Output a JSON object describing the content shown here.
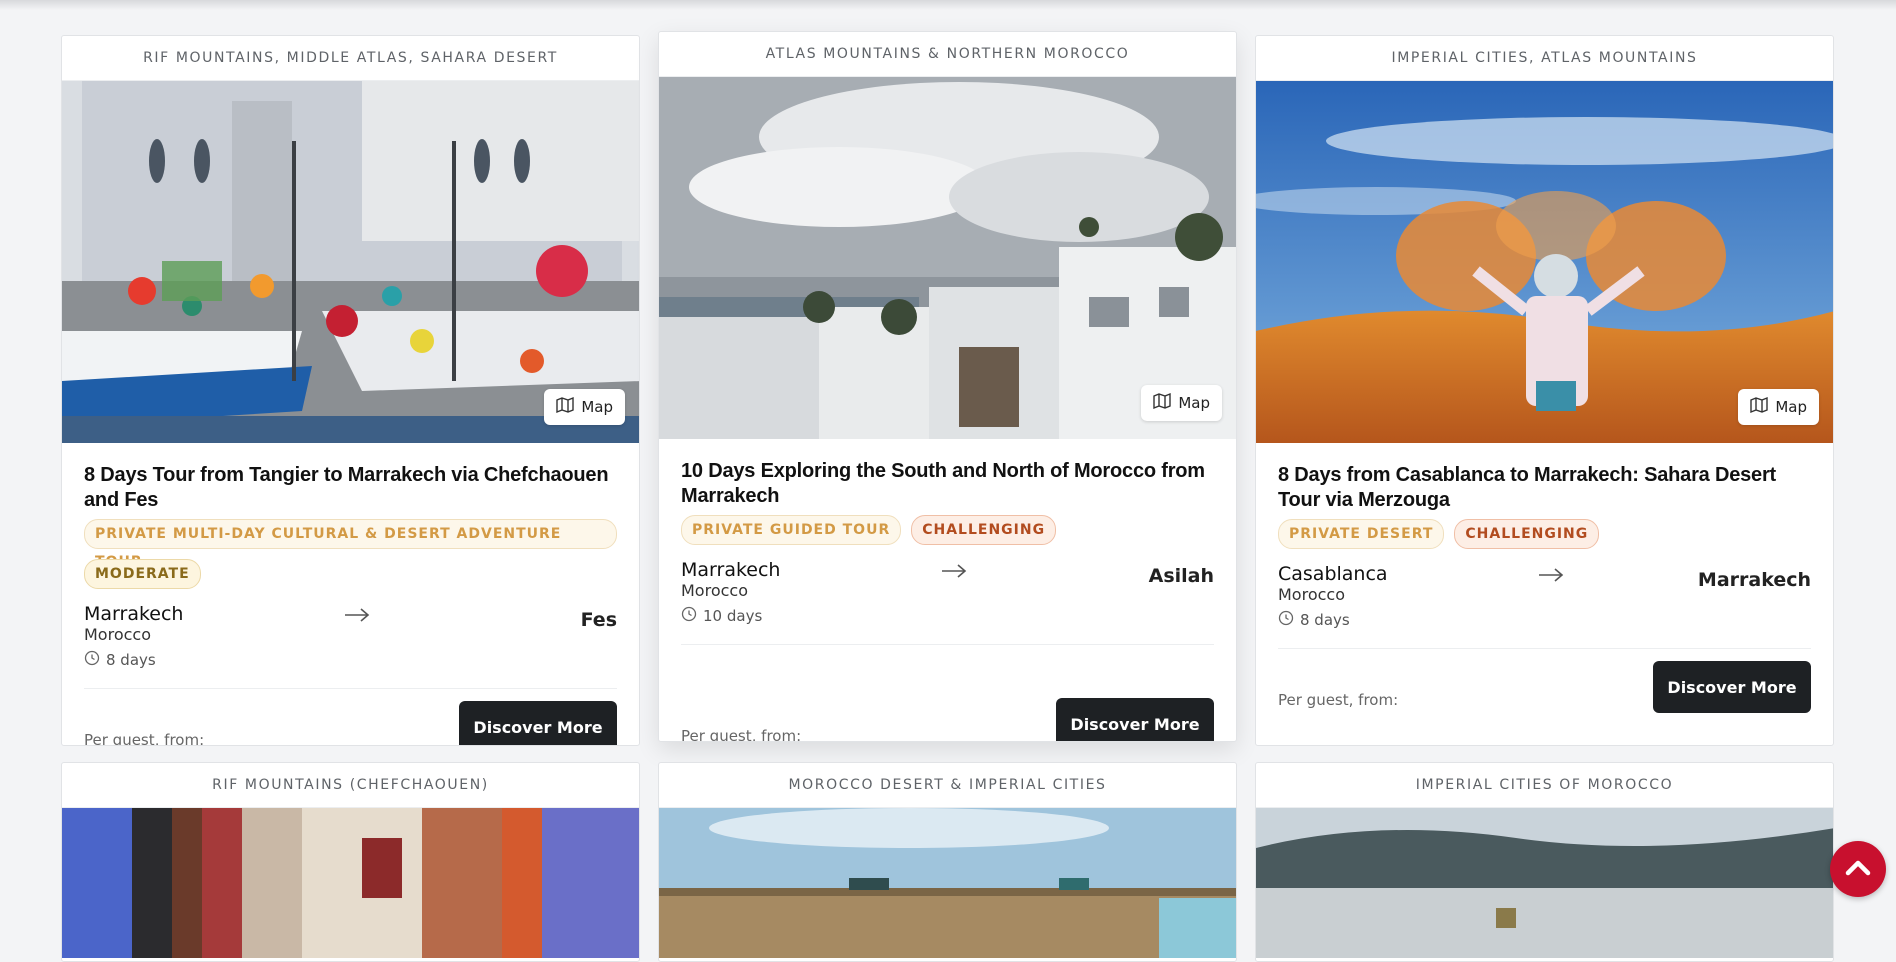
{
  "cards": [
    {
      "region": "RIF MOUNTAINS, MIDDLE ATLAS, SAHARA DESERT",
      "map_label": "Map",
      "title": "8 Days Tour from Tangier to Marrakech via Chefchaouen and Fes",
      "tag_type": "PRIVATE MULTI-DAY CULTURAL & DESERT ADVENTURE TOUR",
      "tag_difficulty": "MODERATE",
      "from_city": "Marrakech",
      "from_country": "Morocco",
      "duration": "8 days",
      "to_city": "Fes",
      "price_label": "Per guest, from:",
      "cta": "Discover More"
    },
    {
      "region": "ATLAS MOUNTAINS & NORTHERN MOROCCO",
      "map_label": "Map",
      "title": "10 Days Exploring the South and North of Morocco from Marrakech",
      "tag_type": "PRIVATE GUIDED TOUR",
      "tag_difficulty": "CHALLENGING",
      "from_city": "Marrakech",
      "from_country": "Morocco",
      "duration": "10 days",
      "to_city": "Asilah",
      "price_label": "Per guest, from:",
      "cta": "Discover More"
    },
    {
      "region": "IMPERIAL CITIES, ATLAS MOUNTAINS",
      "map_label": "Map",
      "title": "8 Days from Casablanca to Marrakech: Sahara Desert Tour via Merzouga",
      "tag_type": "PRIVATE DESERT",
      "tag_difficulty": "CHALLENGING",
      "from_city": "Casablanca",
      "from_country": "Morocco",
      "duration": "8 days",
      "to_city": "Marrakech",
      "price_label": "Per guest, from:",
      "cta": "Discover More"
    },
    {
      "region": "RIF MOUNTAINS (CHEFCHAOUEN)"
    },
    {
      "region": "MOROCCO DESERT & IMPERIAL CITIES"
    },
    {
      "region": "IMPERIAL CITIES OF MOROCCO"
    }
  ],
  "icons": {
    "map": "map-icon",
    "clock": "clock-icon",
    "arrow": "arrow-right-icon",
    "scroll_top": "chevron-up-icon"
  },
  "colors": {
    "cta_bg": "#1e2124",
    "scroll_top_bg": "#c8102e",
    "tag_text": "#d39a45",
    "challenging_text": "#b24c1f"
  }
}
